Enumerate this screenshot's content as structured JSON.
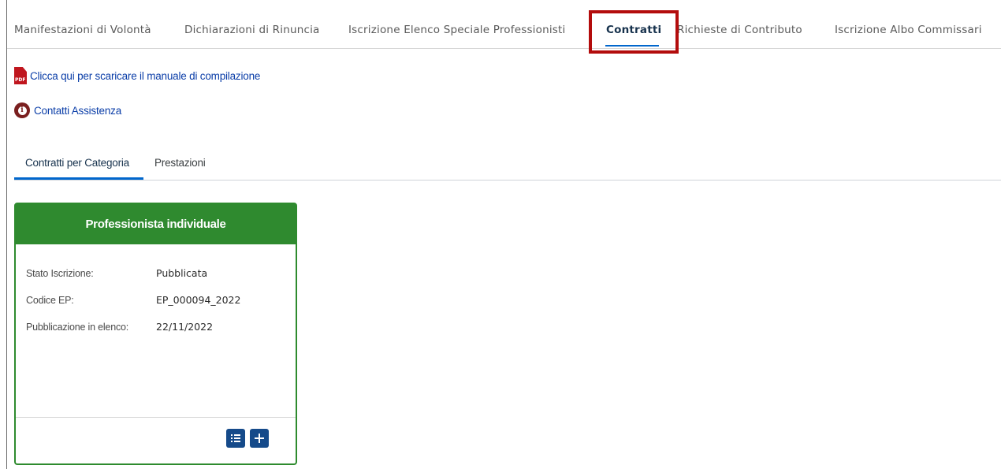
{
  "topnav": {
    "tabs": [
      {
        "label": "Manifestazioni di Volontà"
      },
      {
        "label": "Dichiarazioni di Rinuncia"
      },
      {
        "label": "Iscrizione Elenco Speciale Professionisti"
      },
      {
        "label": "Contratti"
      },
      {
        "label": "Richieste di Contributo"
      },
      {
        "label": "Iscrizione Albo Commissari"
      }
    ],
    "active": "Contratti",
    "highlight_color": "#b30c0c"
  },
  "links": {
    "manual": {
      "label": "Clicca qui per scaricare il manuale di compilazione",
      "icon": "pdf-icon",
      "icon_text": "PDF"
    },
    "support": {
      "label": "Contatti Assistenza",
      "icon": "info-icon"
    }
  },
  "subtabs": {
    "items": [
      {
        "label": "Contratti per Categoria"
      },
      {
        "label": "Prestazioni"
      }
    ],
    "active": "Contratti per Categoria"
  },
  "card": {
    "title": "Professionista individuale",
    "header_color": "#2f8a2f",
    "rows": [
      {
        "label": "Stato Iscrizione:",
        "value": "Pubblicata"
      },
      {
        "label": "Codice EP:",
        "value": "EP_000094_2022"
      },
      {
        "label": "Pubblicazione in elenco:",
        "value": "22/11/2022"
      }
    ],
    "buttons": [
      {
        "icon": "list-icon"
      },
      {
        "icon": "plus-icon"
      }
    ]
  }
}
